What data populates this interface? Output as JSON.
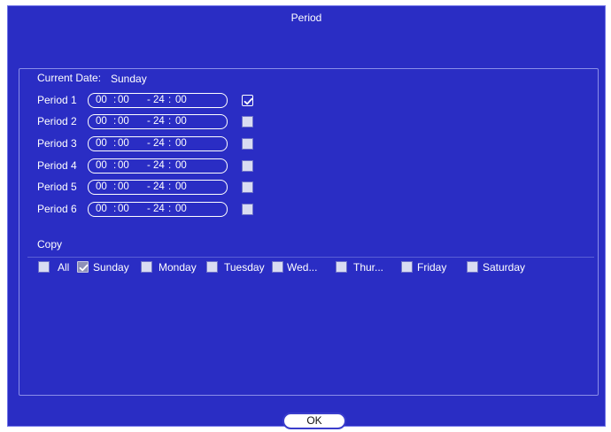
{
  "dialog": {
    "title": "Period"
  },
  "current_date": {
    "label": "Current Date:",
    "value": "Sunday"
  },
  "periods": [
    {
      "label": "Period 1",
      "start_h": "00",
      "start_m": "00",
      "end_h": "24",
      "end_m": "00",
      "enabled": true
    },
    {
      "label": "Period 2",
      "start_h": "00",
      "start_m": "00",
      "end_h": "24",
      "end_m": "00",
      "enabled": false
    },
    {
      "label": "Period 3",
      "start_h": "00",
      "start_m": "00",
      "end_h": "24",
      "end_m": "00",
      "enabled": false
    },
    {
      "label": "Period 4",
      "start_h": "00",
      "start_m": "00",
      "end_h": "24",
      "end_m": "00",
      "enabled": false
    },
    {
      "label": "Period 5",
      "start_h": "00",
      "start_m": "00",
      "end_h": "24",
      "end_m": "00",
      "enabled": false
    },
    {
      "label": "Period 6",
      "start_h": "00",
      "start_m": "00",
      "end_h": "24",
      "end_m": "00",
      "enabled": false
    }
  ],
  "copy": {
    "label": "Copy",
    "days": [
      {
        "label": "All",
        "checked": false
      },
      {
        "label": "Sunday",
        "checked": true
      },
      {
        "label": "Monday",
        "checked": false
      },
      {
        "label": "Tuesday",
        "checked": false
      },
      {
        "label": "Wed...",
        "checked": false
      },
      {
        "label": "Thur...",
        "checked": false
      },
      {
        "label": "Friday",
        "checked": false
      },
      {
        "label": "Saturday",
        "checked": false
      }
    ]
  },
  "buttons": {
    "ok": "OK"
  },
  "colors": {
    "background": "#2a2dc4",
    "text": "#ffffff",
    "checkbox": "#d9dcf2"
  }
}
